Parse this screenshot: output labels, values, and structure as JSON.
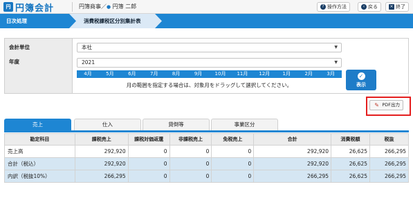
{
  "header": {
    "logo_mark": "円",
    "app_name": "円簿会計",
    "user_office": "円簿商事／",
    "user_bullet": "●",
    "user_name": "円簿 二郎",
    "buttons": [
      {
        "label": "操作方法",
        "icon": "help-icon",
        "glyph": "?"
      },
      {
        "label": "戻る",
        "icon": "back-icon",
        "glyph": "‹"
      },
      {
        "label": "終了",
        "icon": "close-icon",
        "glyph": "×"
      }
    ]
  },
  "nav": {
    "section": "日次処理",
    "current": "消費税課税区分別集計表"
  },
  "filters": {
    "unit_label": "会計単位",
    "unit_value": "本社",
    "year_label": "年度",
    "year_value": "2021",
    "months": [
      "4月",
      "5月",
      "6月",
      "7月",
      "8月",
      "9月",
      "10月",
      "11月",
      "12月",
      "1月",
      "2月",
      "3月"
    ],
    "hint": "月の範囲を指定する場合は、対象月をドラッグして選択してください。",
    "show_button": "表示"
  },
  "pdf_button": "PDF出力",
  "tabs": [
    {
      "label": "売上",
      "active": true
    },
    {
      "label": "仕入",
      "active": false
    },
    {
      "label": "貸倒等",
      "active": false
    },
    {
      "label": "事業区分",
      "active": false
    }
  ],
  "table": {
    "columns": [
      "勘定科目",
      "課税売上",
      "課税対価返還",
      "非課税売上",
      "免税売上",
      "合計",
      "消費税額",
      "税抜"
    ],
    "rows": [
      {
        "cells": [
          "売上高",
          "292,920",
          "0",
          "0",
          "0",
          "292,920",
          "26,625",
          "266,295"
        ],
        "shaded": false
      },
      {
        "cells": [
          "合計（税込）",
          "292,920",
          "0",
          "0",
          "0",
          "292,920",
          "26,625",
          "266,295"
        ],
        "shaded": true
      },
      {
        "cells": [
          "内訳（税抜10%）",
          "266,295",
          "0",
          "0",
          "0",
          "266,295",
          "26,625",
          "266,295"
        ],
        "shaded": true
      }
    ]
  },
  "colors": {
    "accent": "#1e86d3",
    "highlight_frame": "#e41e1e",
    "shaded_row": "#d5e6f3"
  }
}
